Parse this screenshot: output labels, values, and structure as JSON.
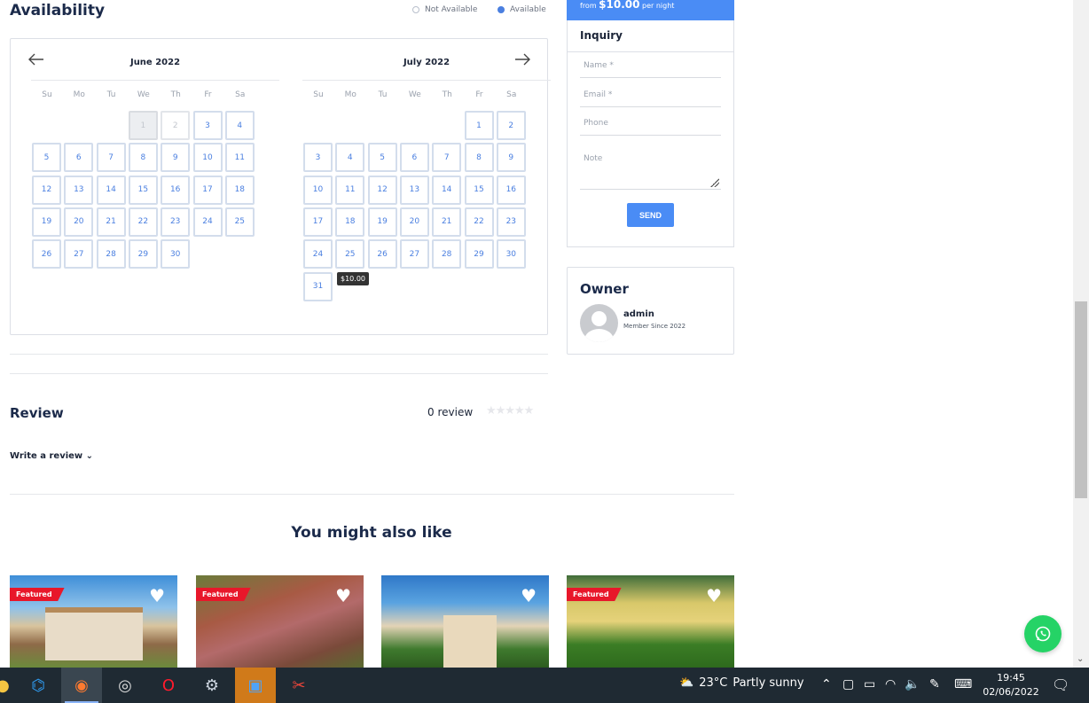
{
  "availability": {
    "title": "Availability",
    "legend_not_available": "Not Available",
    "legend_available": "Available",
    "weekdays": [
      "Su",
      "Mo",
      "Tu",
      "We",
      "Th",
      "Fr",
      "Sa"
    ],
    "june": {
      "title": "June 2022",
      "days": [
        "1",
        "2",
        "3",
        "4",
        "5",
        "6",
        "7",
        "8",
        "9",
        "10",
        "11",
        "12",
        "13",
        "14",
        "15",
        "16",
        "17",
        "18",
        "19",
        "20",
        "21",
        "22",
        "23",
        "24",
        "25",
        "26",
        "27",
        "28",
        "29",
        "30"
      ]
    },
    "july": {
      "title": "July 2022",
      "days": [
        "1",
        "2",
        "3",
        "4",
        "5",
        "6",
        "7",
        "8",
        "9",
        "10",
        "11",
        "12",
        "13",
        "14",
        "15",
        "16",
        "17",
        "18",
        "19",
        "20",
        "21",
        "22",
        "23",
        "24",
        "25",
        "26",
        "27",
        "28",
        "29",
        "30",
        "31"
      ]
    },
    "tooltip": "$10.00"
  },
  "sidebar": {
    "price_prefix": "from",
    "price": "$10.00",
    "price_suffix": "per night",
    "inquiry_title": "Inquiry",
    "name_placeholder": "Name *",
    "email_placeholder": "Email *",
    "phone_placeholder": "Phone",
    "note_placeholder": "Note",
    "send_label": "SEND",
    "owner_title": "Owner",
    "owner_name": "admin",
    "owner_since": "Member Since 2022"
  },
  "review": {
    "title": "Review",
    "count": "0 review",
    "stars": "★★★★★",
    "write_label": "Write a review ⌄"
  },
  "also": {
    "title": "You might also like",
    "cards": [
      {
        "badge": "Featured"
      },
      {
        "badge": "Featured"
      },
      {
        "badge": ""
      },
      {
        "badge": "Featured"
      }
    ]
  },
  "taskbar": {
    "temperature": "23°C",
    "weather": "Partly sunny",
    "time": "19:45",
    "date": "02/06/2022"
  }
}
